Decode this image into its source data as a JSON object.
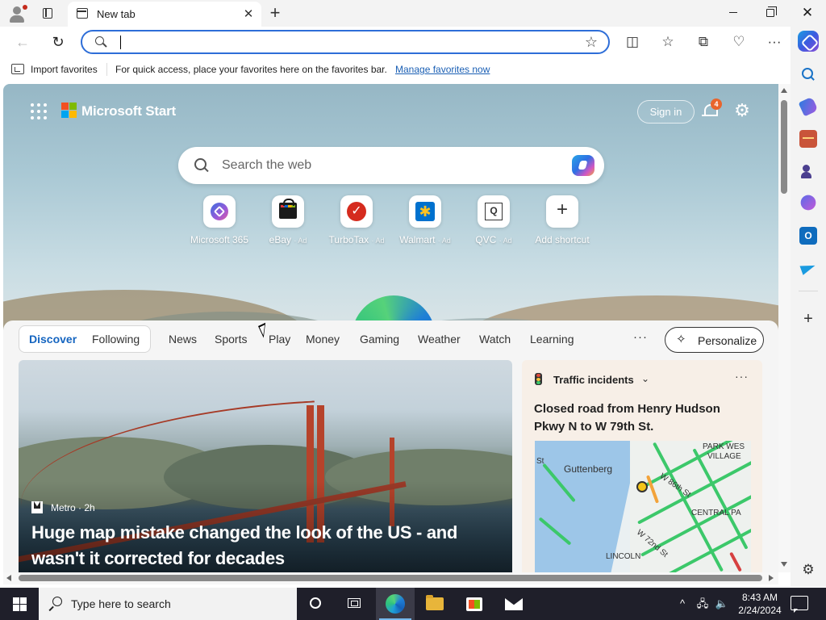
{
  "browser": {
    "tab_title": "New tab",
    "tab_close": "✕",
    "new_tab": "+",
    "window_close": "✕",
    "back": "←",
    "refresh": "↻",
    "address_value": "",
    "favorite_star": "☆",
    "tools": {
      "split_screen": "◫",
      "favorites": "☆",
      "collections": "⧉",
      "performance": "♡",
      "more": "···"
    }
  },
  "favbar": {
    "import_label": "Import favorites",
    "message": "For quick access, place your favorites here on the favorites bar.",
    "manage_link": "Manage favorites now"
  },
  "sidebar": {
    "add": "+",
    "settings": "⚙",
    "outlook_letter": "O"
  },
  "start": {
    "brand": "Microsoft Start",
    "signin": "Sign in",
    "notifications_count": "4",
    "settings_glyph": "⚙",
    "search_placeholder": "Search the web",
    "shortcuts": [
      {
        "name": "Microsoft 365",
        "ad": ""
      },
      {
        "name": "eBay",
        "ad": "· Ad"
      },
      {
        "name": "TurboTax",
        "ad": "· Ad"
      },
      {
        "name": "Walmart",
        "ad": "· Ad"
      },
      {
        "name": "QVC",
        "ad": "· Ad"
      },
      {
        "name": "Add shortcut",
        "ad": ""
      }
    ],
    "shortcut_glyphs": {
      "turbotax": "✓",
      "walmart": "✱",
      "qvc": "Q",
      "add": "+"
    }
  },
  "feed": {
    "tabs": [
      "Discover",
      "Following",
      "News",
      "Sports",
      "Play",
      "Money",
      "Gaming",
      "Weather",
      "Watch",
      "Learning"
    ],
    "more": "···",
    "personalize": "Personalize",
    "personalize_glyph": "✧",
    "hero": {
      "source": "Metro · 2h",
      "title": "Huge map mistake changed the look of the US - and wasn't it corrected for decades"
    },
    "traffic": {
      "header": "Traffic incidents",
      "chevron": "⌄",
      "more": "···",
      "title": "Closed road from Henry Hudson Pkwy N to W 79th St.",
      "map_labels": {
        "guttenberg": "Guttenberg",
        "park_west": "PARK WES",
        "village": "VILLAGE",
        "w86": "W 86th St",
        "central_park": "CENTRAL PA",
        "w72": "W 72nd St",
        "lincoln": "LINCOLN",
        "st": "St"
      }
    }
  },
  "taskbar": {
    "search_placeholder": "Type here to search",
    "time": "8:43 AM",
    "date": "2/24/2024",
    "tray": {
      "chevron": "^",
      "network": "🖧",
      "volume": "🔈"
    }
  },
  "colors": {
    "accent": "#1565c0",
    "address_border": "#2e6ed8",
    "taskbar": "#1f1f2a",
    "notification_badge": "#e8642c"
  }
}
